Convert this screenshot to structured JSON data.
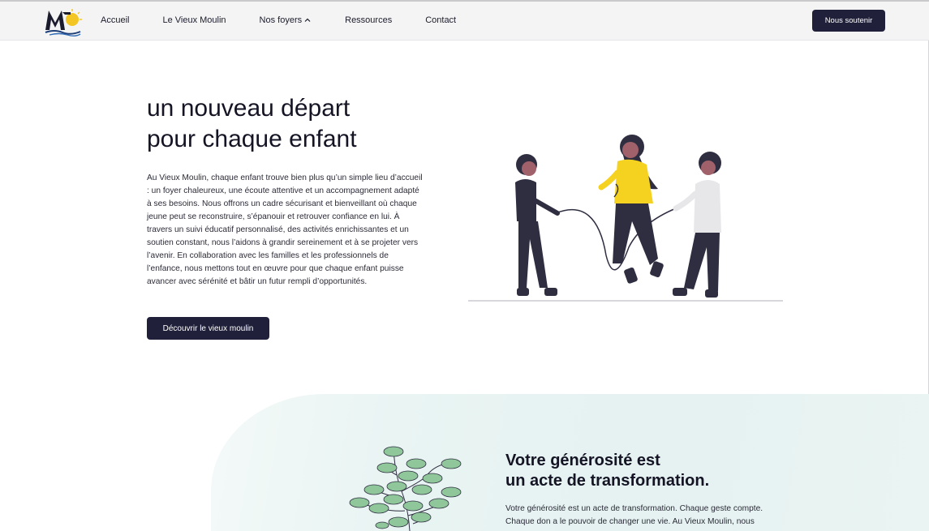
{
  "colors": {
    "accent": "#20203a",
    "yellow": "#f5d21f",
    "leaf": "#8fc79a",
    "bg_section": "#e8f4f3"
  },
  "header": {
    "logo_icon": "vieux-moulin-logo",
    "nav": {
      "home": "Accueil",
      "about": "Le Vieux Moulin",
      "homes": "Nos foyers",
      "resources": "Ressources",
      "contact": "Contact"
    },
    "support_button": "Nous soutenir"
  },
  "hero": {
    "title_line1": "un nouveau départ",
    "title_line2": "pour chaque enfant",
    "paragraph": "Au Vieux Moulin, chaque enfant trouve bien plus qu’un simple lieu d’accueil : un foyer chaleureux, une écoute attentive et un accompagnement adapté à ses besoins. Nous offrons un cadre sécurisant et bienveillant où chaque jeune peut se reconstruire, s’épanouir et retrouver confiance en lui. À travers un suivi éducatif personnalisé, des activités enrichissantes et un soutien constant, nous l’aidons à grandir sereinement et à se projeter vers l’avenir. En collaboration avec les familles et les professionnels de l’enfance, nous mettons tout en œuvre pour que chaque enfant puisse avancer avec sérénité et bâtir un futur rempli d’opportunités.",
    "button": "Découvrir le vieux moulin",
    "illustration_icon": "children-jump-rope-illustration"
  },
  "generosity": {
    "title_line1": "Votre générosité est",
    "title_line2": "un acte de transformation.",
    "paragraph": "Votre générosité est un acte de transformation. Chaque geste compte. Chaque don a le pouvoir de changer une vie. Au Vieux Moulin, nous",
    "illustration_icon": "money-tree-illustration"
  }
}
